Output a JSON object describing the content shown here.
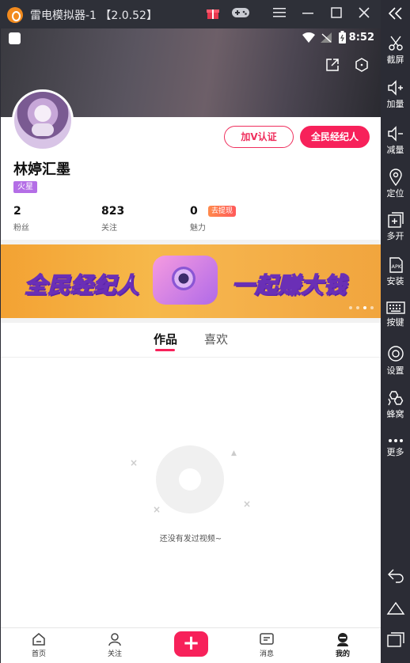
{
  "window": {
    "title": "雷电模拟器-1 【2.0.52】"
  },
  "status_bar": {
    "time": "8:52"
  },
  "profile": {
    "name": "林婷汇墨",
    "badge": "火星",
    "verify_button": "加V认证",
    "agent_button": "全民经纪人",
    "stats": [
      {
        "value": "2",
        "label": "粉丝"
      },
      {
        "value": "823",
        "label": "关注"
      },
      {
        "value": "0",
        "label": "魅力"
      }
    ],
    "withdraw_tag": "去提现"
  },
  "banner": {
    "left_text": "全民经纪人",
    "right_text": "一起赚大钱"
  },
  "tabs": [
    {
      "label": "作品",
      "active": true
    },
    {
      "label": "喜欢",
      "active": false
    }
  ],
  "empty_state": {
    "text": "还没有发过视频~"
  },
  "bottom_nav": [
    {
      "label": "首页",
      "icon": "home-icon"
    },
    {
      "label": "关注",
      "icon": "follow-icon"
    },
    {
      "label": "",
      "icon": "plus-icon"
    },
    {
      "label": "消息",
      "icon": "message-icon"
    },
    {
      "label": "我的",
      "icon": "me-icon",
      "active": true
    }
  ],
  "sidebar": {
    "items": [
      {
        "label": "截屏",
        "icon": "scissors-icon"
      },
      {
        "label": "加量",
        "icon": "volume-up-icon"
      },
      {
        "label": "减量",
        "icon": "volume-down-icon"
      },
      {
        "label": "定位",
        "icon": "location-icon"
      },
      {
        "label": "多开",
        "icon": "multi-open-icon"
      },
      {
        "label": "安装",
        "icon": "apk-install-icon"
      },
      {
        "label": "按键",
        "icon": "keyboard-icon"
      },
      {
        "label": "设置",
        "icon": "settings-icon"
      },
      {
        "label": "蜂窝",
        "icon": "beehive-icon"
      },
      {
        "label": "更多",
        "icon": "more-icon"
      }
    ]
  },
  "colors": {
    "accent": "#f7215a",
    "badge": "#b46ee6",
    "chrome": "#2b2c35"
  }
}
